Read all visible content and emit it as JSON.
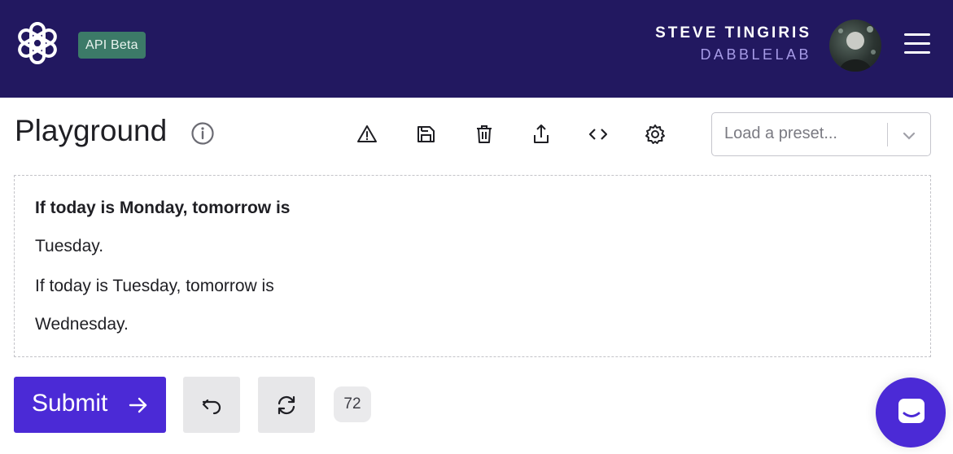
{
  "header": {
    "logo_icon": "openai-logo-icon",
    "badge": "API Beta",
    "user_name": "STEVE TINGIRIS",
    "org_name": "DABBLELAB",
    "menu_icon": "hamburger-menu-icon"
  },
  "toolbar": {
    "title": "Playground",
    "info_icon": "info-icon",
    "tools": [
      "warning-icon",
      "save-icon",
      "trash-icon",
      "share-icon",
      "code-icon",
      "gear-icon"
    ],
    "preset_placeholder": "Load a preset..."
  },
  "editor": {
    "lines": [
      "If today is Monday, tomorrow is",
      "Tuesday.",
      "If today is Tuesday, tomorrow is",
      "Wednesday."
    ]
  },
  "actions": {
    "submit_label": "Submit",
    "undo_icon": "undo-icon",
    "regenerate_icon": "regenerate-icon",
    "token_count": "72",
    "chat_icon": "chat-icon"
  },
  "colors": {
    "header_bg": "#221860",
    "accent": "#4b2ad6",
    "badge_bg": "#3c7a68",
    "org_text": "#a69be6"
  }
}
